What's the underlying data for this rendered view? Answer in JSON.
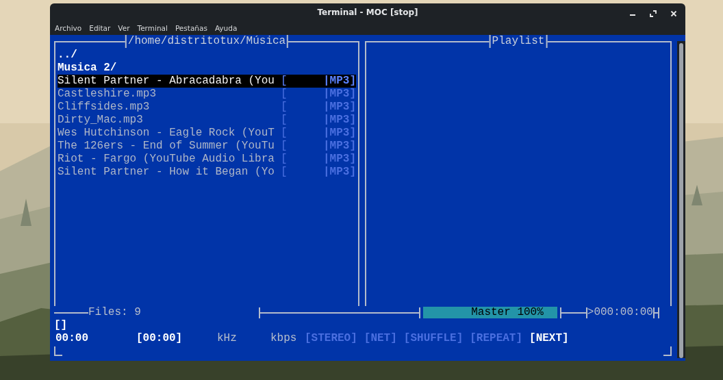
{
  "window": {
    "title": "Terminal - MOC [stop]"
  },
  "menu": [
    "Archivo",
    "Editar",
    "Ver",
    "Terminal",
    "Pestañas",
    "Ayuda"
  ],
  "browser": {
    "title": "/home/distritotux/Música",
    "items": [
      {
        "kind": "dir",
        "name": "../",
        "selected": false
      },
      {
        "kind": "dir",
        "name": "Musica 2/",
        "selected": false
      },
      {
        "kind": "file",
        "name": "Silent Partner - Abracadabra (You",
        "tag_open": "[",
        "format": "|MP3]",
        "selected": true
      },
      {
        "kind": "file",
        "name": "Castleshire.mp3",
        "tag_open": "[",
        "format": "|MP3]",
        "selected": false
      },
      {
        "kind": "file",
        "name": "Cliffsides.mp3",
        "tag_open": "[",
        "format": "|MP3]",
        "selected": false
      },
      {
        "kind": "file",
        "name": "Dirty_Mac.mp3",
        "tag_open": "[",
        "format": "|MP3]",
        "selected": false
      },
      {
        "kind": "file",
        "name": "Wes Hutchinson - Eagle Rock (YouT",
        "tag_open": "[",
        "format": "|MP3]",
        "selected": false
      },
      {
        "kind": "file",
        "name": "The 126ers - End of Summer (YouTu",
        "tag_open": "[",
        "format": "|MP3]",
        "selected": false
      },
      {
        "kind": "file",
        "name": "Riot - Fargo (YouTube Audio Libra",
        "tag_open": "[",
        "format": "|MP3]",
        "selected": false
      },
      {
        "kind": "file",
        "name": "Silent Partner - How it Began (Yo",
        "tag_open": "[",
        "format": "|MP3]",
        "selected": false
      }
    ]
  },
  "playlist": {
    "title": "Playlist"
  },
  "status": {
    "files": "Files: 9",
    "volume": {
      "label": "Master 100%",
      "level": 1
    },
    "total_time": ">000:00:00",
    "title_line": "[]",
    "elapsed": "00:00",
    "duration": "[00:00]",
    "rate": "kHz",
    "bitrate": "kbps",
    "toggles": [
      {
        "label": "[STEREO]",
        "on": false
      },
      {
        "label": "[NET]",
        "on": false
      },
      {
        "label": "[SHUFFLE]",
        "on": false
      },
      {
        "label": "[REPEAT]",
        "on": false
      },
      {
        "label": "[NEXT]",
        "on": true
      }
    ]
  }
}
